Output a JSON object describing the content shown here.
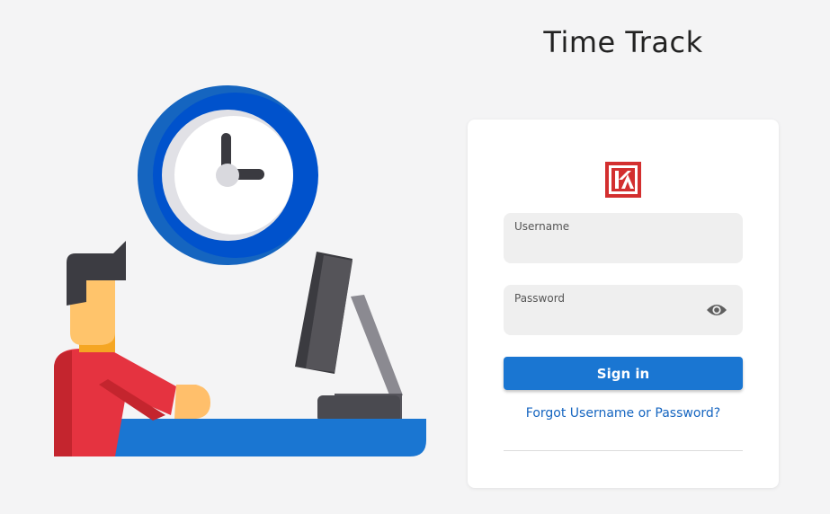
{
  "header": {
    "title": "Time Track"
  },
  "login": {
    "username_label": "Username",
    "username_value": "",
    "password_label": "Password",
    "password_value": "",
    "signin_label": "Sign in",
    "forgot_link": "Forgot Username or Password?"
  },
  "icons": {
    "logo": "ka-logo",
    "password_toggle": "eye-icon",
    "illustration": "person-at-desk-with-clock"
  },
  "colors": {
    "primary": "#1a76d2",
    "link": "#1565c0",
    "logo_red": "#d32f2f",
    "background": "#f4f4f5",
    "clock_blue": "#0052cc"
  }
}
